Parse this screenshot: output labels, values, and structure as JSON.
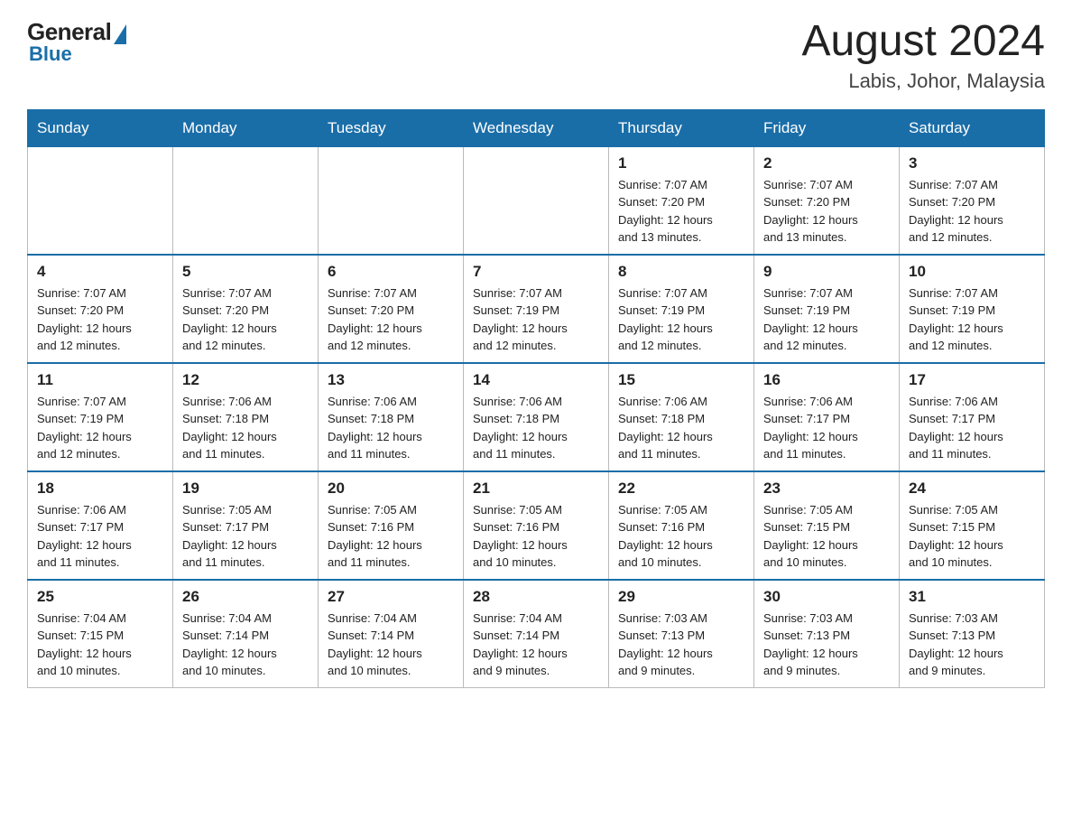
{
  "header": {
    "logo": {
      "general_text": "General",
      "blue_text": "Blue"
    },
    "title": "August 2024",
    "location": "Labis, Johor, Malaysia"
  },
  "days_of_week": [
    "Sunday",
    "Monday",
    "Tuesday",
    "Wednesday",
    "Thursday",
    "Friday",
    "Saturday"
  ],
  "weeks": [
    [
      {
        "day": "",
        "info": ""
      },
      {
        "day": "",
        "info": ""
      },
      {
        "day": "",
        "info": ""
      },
      {
        "day": "",
        "info": ""
      },
      {
        "day": "1",
        "info": "Sunrise: 7:07 AM\nSunset: 7:20 PM\nDaylight: 12 hours\nand 13 minutes."
      },
      {
        "day": "2",
        "info": "Sunrise: 7:07 AM\nSunset: 7:20 PM\nDaylight: 12 hours\nand 13 minutes."
      },
      {
        "day": "3",
        "info": "Sunrise: 7:07 AM\nSunset: 7:20 PM\nDaylight: 12 hours\nand 12 minutes."
      }
    ],
    [
      {
        "day": "4",
        "info": "Sunrise: 7:07 AM\nSunset: 7:20 PM\nDaylight: 12 hours\nand 12 minutes."
      },
      {
        "day": "5",
        "info": "Sunrise: 7:07 AM\nSunset: 7:20 PM\nDaylight: 12 hours\nand 12 minutes."
      },
      {
        "day": "6",
        "info": "Sunrise: 7:07 AM\nSunset: 7:20 PM\nDaylight: 12 hours\nand 12 minutes."
      },
      {
        "day": "7",
        "info": "Sunrise: 7:07 AM\nSunset: 7:19 PM\nDaylight: 12 hours\nand 12 minutes."
      },
      {
        "day": "8",
        "info": "Sunrise: 7:07 AM\nSunset: 7:19 PM\nDaylight: 12 hours\nand 12 minutes."
      },
      {
        "day": "9",
        "info": "Sunrise: 7:07 AM\nSunset: 7:19 PM\nDaylight: 12 hours\nand 12 minutes."
      },
      {
        "day": "10",
        "info": "Sunrise: 7:07 AM\nSunset: 7:19 PM\nDaylight: 12 hours\nand 12 minutes."
      }
    ],
    [
      {
        "day": "11",
        "info": "Sunrise: 7:07 AM\nSunset: 7:19 PM\nDaylight: 12 hours\nand 12 minutes."
      },
      {
        "day": "12",
        "info": "Sunrise: 7:06 AM\nSunset: 7:18 PM\nDaylight: 12 hours\nand 11 minutes."
      },
      {
        "day": "13",
        "info": "Sunrise: 7:06 AM\nSunset: 7:18 PM\nDaylight: 12 hours\nand 11 minutes."
      },
      {
        "day": "14",
        "info": "Sunrise: 7:06 AM\nSunset: 7:18 PM\nDaylight: 12 hours\nand 11 minutes."
      },
      {
        "day": "15",
        "info": "Sunrise: 7:06 AM\nSunset: 7:18 PM\nDaylight: 12 hours\nand 11 minutes."
      },
      {
        "day": "16",
        "info": "Sunrise: 7:06 AM\nSunset: 7:17 PM\nDaylight: 12 hours\nand 11 minutes."
      },
      {
        "day": "17",
        "info": "Sunrise: 7:06 AM\nSunset: 7:17 PM\nDaylight: 12 hours\nand 11 minutes."
      }
    ],
    [
      {
        "day": "18",
        "info": "Sunrise: 7:06 AM\nSunset: 7:17 PM\nDaylight: 12 hours\nand 11 minutes."
      },
      {
        "day": "19",
        "info": "Sunrise: 7:05 AM\nSunset: 7:17 PM\nDaylight: 12 hours\nand 11 minutes."
      },
      {
        "day": "20",
        "info": "Sunrise: 7:05 AM\nSunset: 7:16 PM\nDaylight: 12 hours\nand 11 minutes."
      },
      {
        "day": "21",
        "info": "Sunrise: 7:05 AM\nSunset: 7:16 PM\nDaylight: 12 hours\nand 10 minutes."
      },
      {
        "day": "22",
        "info": "Sunrise: 7:05 AM\nSunset: 7:16 PM\nDaylight: 12 hours\nand 10 minutes."
      },
      {
        "day": "23",
        "info": "Sunrise: 7:05 AM\nSunset: 7:15 PM\nDaylight: 12 hours\nand 10 minutes."
      },
      {
        "day": "24",
        "info": "Sunrise: 7:05 AM\nSunset: 7:15 PM\nDaylight: 12 hours\nand 10 minutes."
      }
    ],
    [
      {
        "day": "25",
        "info": "Sunrise: 7:04 AM\nSunset: 7:15 PM\nDaylight: 12 hours\nand 10 minutes."
      },
      {
        "day": "26",
        "info": "Sunrise: 7:04 AM\nSunset: 7:14 PM\nDaylight: 12 hours\nand 10 minutes."
      },
      {
        "day": "27",
        "info": "Sunrise: 7:04 AM\nSunset: 7:14 PM\nDaylight: 12 hours\nand 10 minutes."
      },
      {
        "day": "28",
        "info": "Sunrise: 7:04 AM\nSunset: 7:14 PM\nDaylight: 12 hours\nand 9 minutes."
      },
      {
        "day": "29",
        "info": "Sunrise: 7:03 AM\nSunset: 7:13 PM\nDaylight: 12 hours\nand 9 minutes."
      },
      {
        "day": "30",
        "info": "Sunrise: 7:03 AM\nSunset: 7:13 PM\nDaylight: 12 hours\nand 9 minutes."
      },
      {
        "day": "31",
        "info": "Sunrise: 7:03 AM\nSunset: 7:13 PM\nDaylight: 12 hours\nand 9 minutes."
      }
    ]
  ],
  "colors": {
    "header_bg": "#1a6ea8",
    "accent_blue": "#1a6ea8"
  }
}
